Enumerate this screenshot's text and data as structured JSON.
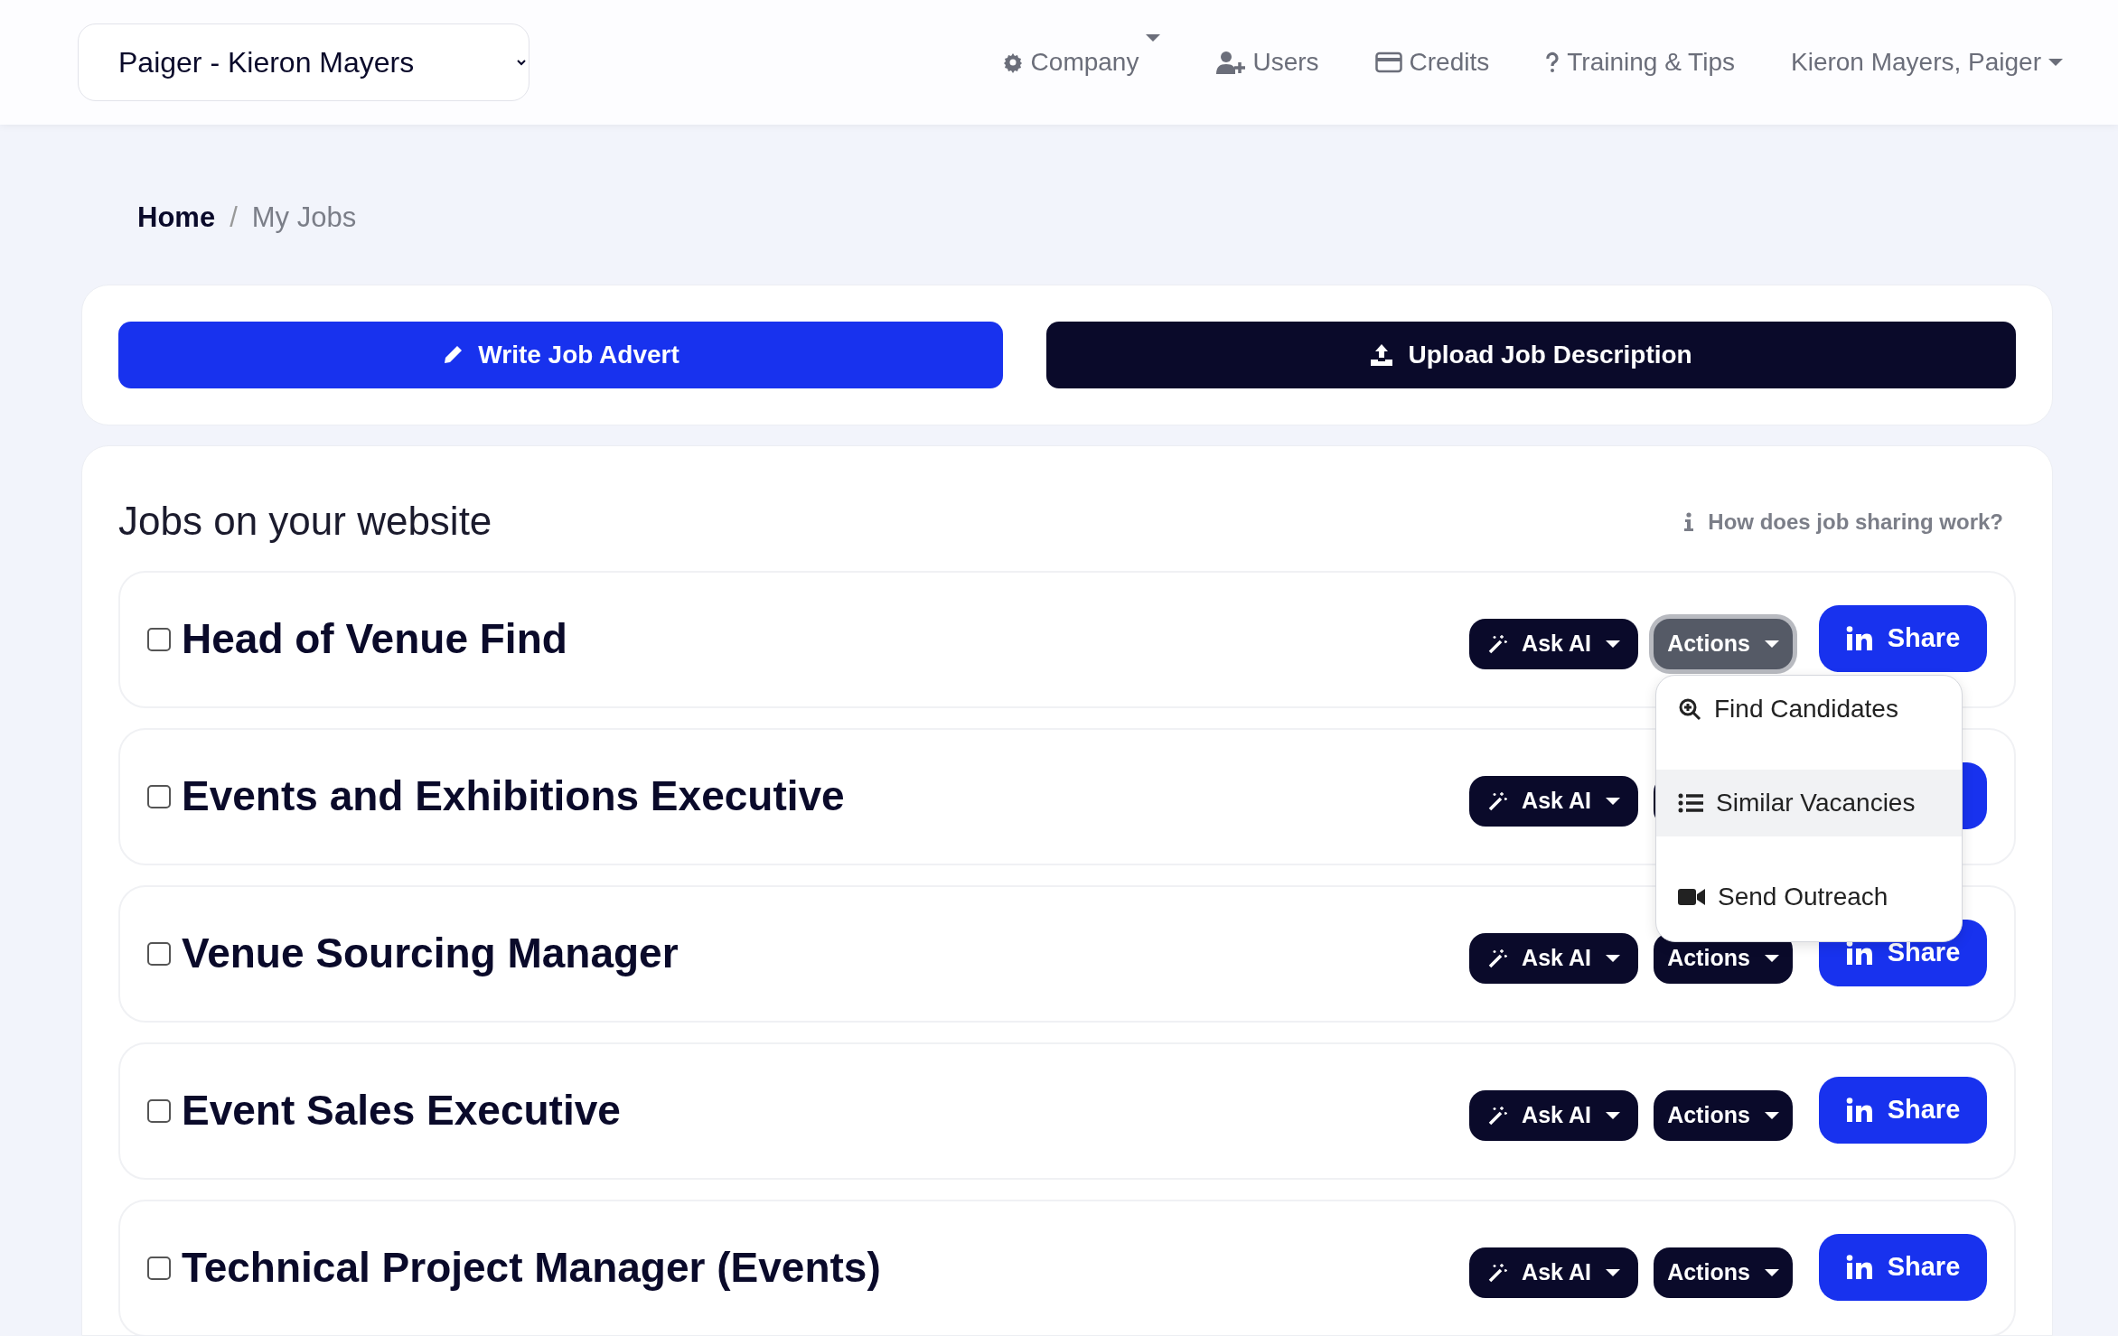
{
  "org_select": {
    "value": "Paiger - Kieron Mayers"
  },
  "nav": [
    {
      "label": "Company",
      "dropdown": true
    },
    {
      "label": "Users",
      "dropdown": false
    },
    {
      "label": "Credits",
      "dropdown": false
    },
    {
      "label": "Training & Tips",
      "dropdown": false
    },
    {
      "label": "Kieron Mayers, Paiger",
      "dropdown": true
    }
  ],
  "breadcrumb_separator": "/",
  "breadcrumb": [
    {
      "label": "Home",
      "selected": false
    },
    {
      "label": "My Jobs",
      "selected": true
    }
  ],
  "top_actions": [
    {
      "label": "Write Job Advert",
      "kind": "primary"
    },
    {
      "label": "Upload Job Description",
      "kind": "dark"
    }
  ],
  "jobs_section": {
    "title": "Jobs on your website",
    "help": "How does job sharing work?"
  },
  "jobs": [
    {
      "title": "Head of Venue Find",
      "checked": false,
      "ask_ai": "Ask AI",
      "actions": "Actions",
      "actions_open": true,
      "share": "Share"
    },
    {
      "title": "Events and Exhibitions Executive",
      "checked": false,
      "ask_ai": "Ask AI",
      "actions_open": false
    },
    {
      "title": "Venue Sourcing Manager",
      "checked": false,
      "ask_ai": "Ask AI",
      "actions": "Actions",
      "actions_open": false,
      "share": "Share"
    },
    {
      "title": "Event Sales Executive",
      "checked": false,
      "ask_ai": "Ask AI",
      "actions": "Actions",
      "actions_open": false,
      "share": "Share"
    },
    {
      "title": "Technical Project Manager (Events)",
      "checked": false,
      "ask_ai": "Ask AI",
      "actions": "Actions",
      "actions_open": false,
      "share": "Share"
    }
  ],
  "actions_menu": [
    {
      "label": "Find Candidates",
      "selected": false
    },
    {
      "label": "Similar Vacancies",
      "selected": true
    },
    {
      "label": "Send Outreach",
      "selected": false
    }
  ]
}
